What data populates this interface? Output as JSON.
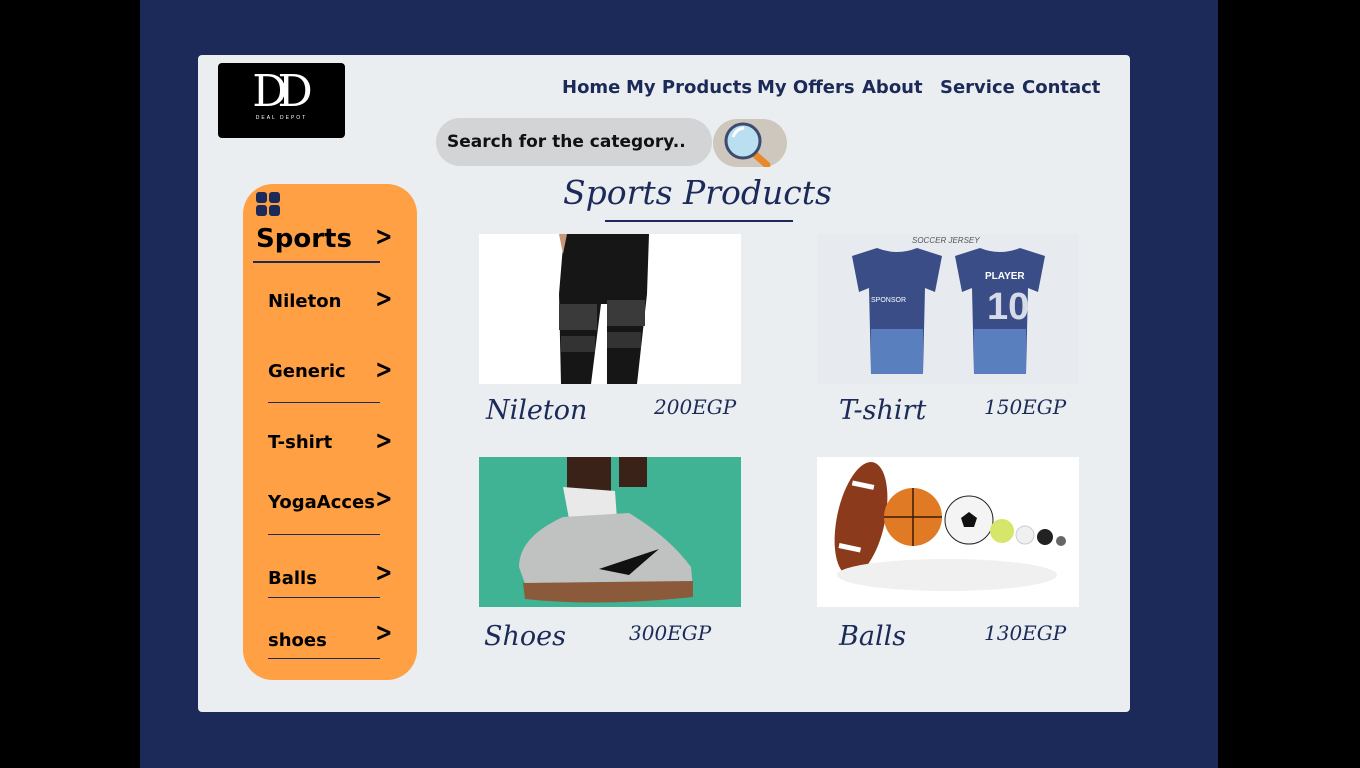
{
  "logo": {
    "mark": "DD",
    "tagline": "DEAL DEPOT"
  },
  "nav": [
    "Home",
    "My Products",
    "My Offers",
    "About",
    "Service",
    "Contact"
  ],
  "search": {
    "placeholder": "Search for the category.."
  },
  "sidebar": {
    "title": "Sports",
    "items": [
      "Nileton",
      "Generic",
      "T-shirt",
      "YogaAcces",
      "Balls",
      "shoes"
    ]
  },
  "heading": "Sports Products",
  "products": [
    {
      "name": "Nileton",
      "price": "200EGP"
    },
    {
      "name": "T-shirt",
      "price": "150EGP"
    },
    {
      "name": "Shoes",
      "price": "300EGP"
    },
    {
      "name": "Balls",
      "price": "130EGP"
    }
  ],
  "colors": {
    "navy": "#1b2a58",
    "orange": "#ffa044",
    "card": "#eaeef0"
  }
}
